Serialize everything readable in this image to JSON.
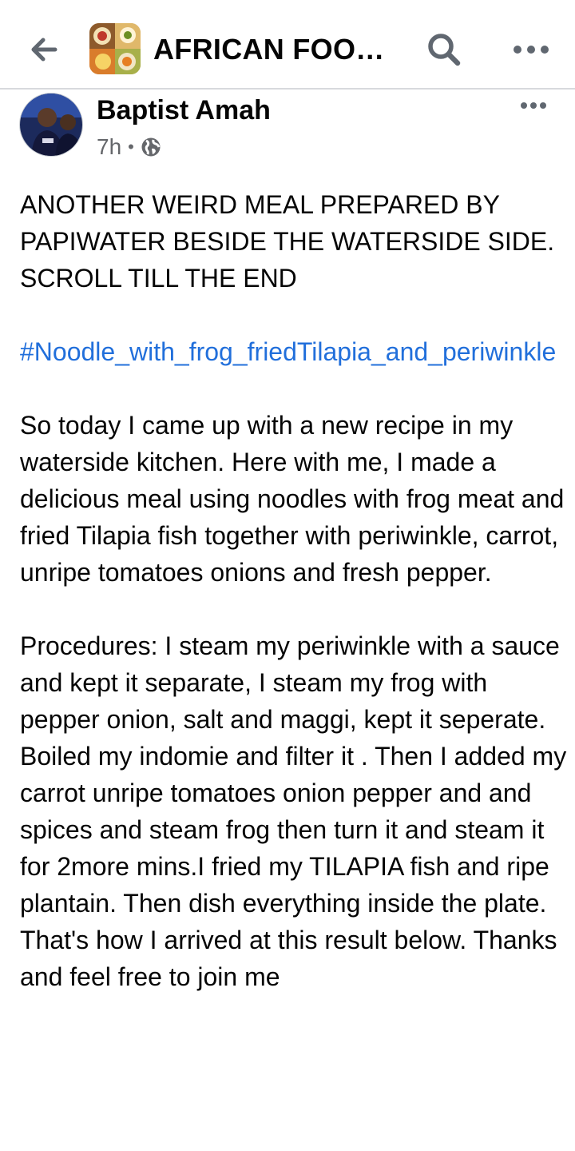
{
  "header": {
    "back_icon": "arrow-left-icon",
    "group_title": "AFRICAN FOOD…",
    "search_icon": "search-icon",
    "more_icon": "more-horizontal-icon"
  },
  "post": {
    "author": "Baptist Amah",
    "time": "7h",
    "separator": "•",
    "audience_icon": "globe-icon",
    "more_icon": "more-horizontal-icon",
    "intro": "ANOTHER  WEIRD MEAL PREPARED BY PAPIWATER BESIDE THE WATERSIDE SIDE. SCROLL TILL THE END",
    "hashtag": "#Noodle_with_frog_friedTilapia_and_periwinkle",
    "paragraph1": "So today I came up with a new recipe in my waterside kitchen. Here with me, I made a delicious meal using noodles with frog meat and fried Tilapia fish together with periwinkle, carrot, unripe tomatoes onions and fresh pepper.",
    "paragraph2": "Procedures: I steam my periwinkle with a sauce and kept it separate, I steam my frog with pepper onion, salt and maggi, kept it seperate. Boiled my indomie and filter it . Then I added my carrot  unripe tomatoes onion pepper and and spices and steam frog then  turn it and steam it for 2more mins.I fried my TILAPIA fish and ripe plantain. Then dish everything inside the plate. That's how I arrived at this result below. Thanks and feel free to join me"
  },
  "colors": {
    "link": "#216fdb",
    "meta": "#65676b",
    "icon": "#606770",
    "divider": "#d7d9dd"
  }
}
